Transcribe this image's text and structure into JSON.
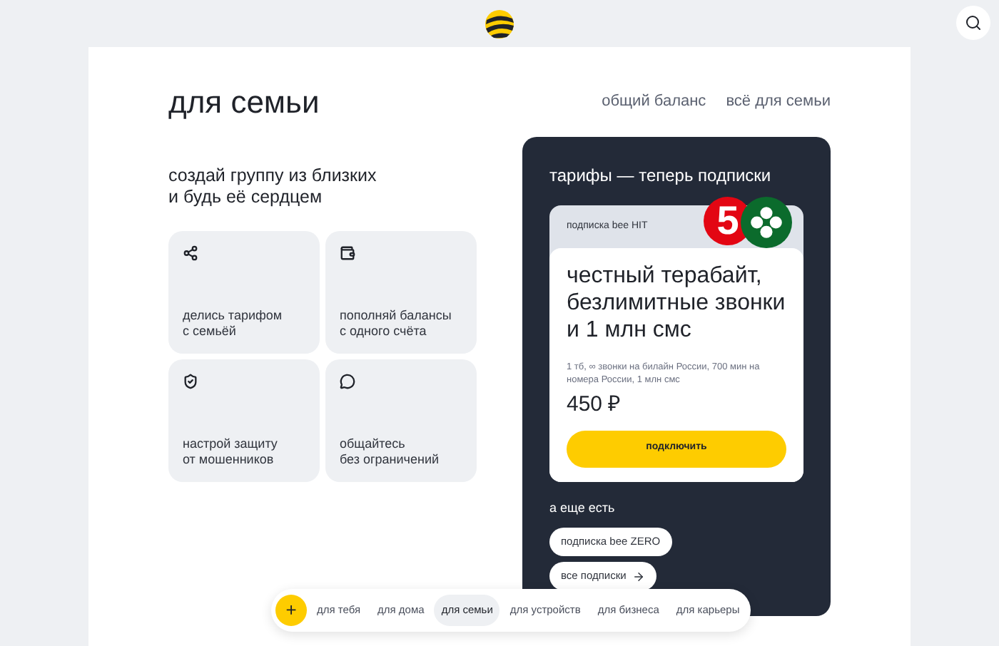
{
  "page": {
    "title": "для семьи",
    "links": [
      "общий баланс",
      "всё для семьи"
    ]
  },
  "intro": "создай группу из близких\nи будь её сердцем",
  "features": [
    {
      "kind": "share",
      "text": "делись тарифом\nс семьёй"
    },
    {
      "kind": "wallet",
      "text": "пополняй балансы\nс одного счёта"
    },
    {
      "kind": "shield",
      "text": "настрой защиту\nот мошенников"
    },
    {
      "kind": "chat",
      "text": "общайтесь\nбез ограничений"
    }
  ],
  "tariffs": {
    "title": "тарифы — теперь подписки",
    "card": {
      "label": "подписка bee HIT",
      "logo_text": "5",
      "headline": "честный терабайт, безлимитные звонки и 1 млн смс",
      "details": "1 тб, ∞ звонки на билайн России, 700 мин на номера России, 1 млн смс",
      "price": "450 ₽",
      "button": "подключить"
    },
    "more_title": "а еще есть",
    "more": [
      {
        "label": "подписка bee ZERO",
        "arrow": false
      },
      {
        "label": "все подписки",
        "arrow": true
      }
    ]
  },
  "nav": {
    "plus": "+",
    "items": [
      {
        "label": "для тебя",
        "selected": false
      },
      {
        "label": "для дома",
        "selected": false
      },
      {
        "label": "для семьи",
        "selected": true
      },
      {
        "label": "для устройств",
        "selected": false
      },
      {
        "label": "для бизнеса",
        "selected": false
      },
      {
        "label": "для карьеры",
        "selected": false
      }
    ]
  }
}
